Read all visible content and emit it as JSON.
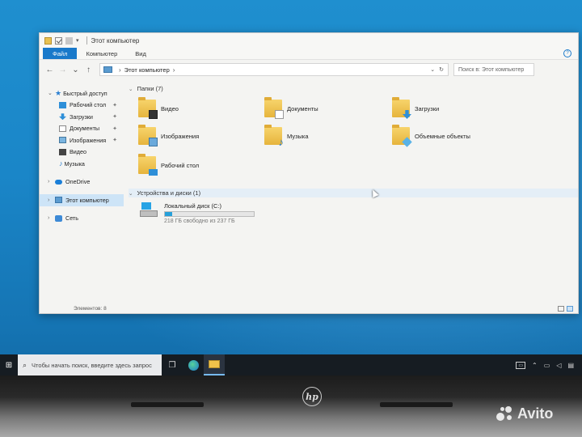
{
  "window": {
    "title": "Этот компьютер",
    "ribbon_tabs": [
      "Файл",
      "Компьютер",
      "Вид"
    ],
    "help": "?"
  },
  "address": {
    "path": "Этот компьютер",
    "search_placeholder": "Поиск в: Этот компьютер"
  },
  "sidebar": {
    "quick_access": "Быстрый доступ",
    "quick_items": [
      {
        "label": "Рабочий стол",
        "icon": "desktop-icon",
        "pinned": true
      },
      {
        "label": "Загрузки",
        "icon": "download-icon",
        "pinned": true
      },
      {
        "label": "Документы",
        "icon": "documents-icon",
        "pinned": true
      },
      {
        "label": "Изображения",
        "icon": "pictures-icon",
        "pinned": true
      },
      {
        "label": "Видео",
        "icon": "video-icon",
        "pinned": false
      },
      {
        "label": "Музыка",
        "icon": "music-icon",
        "pinned": false
      }
    ],
    "onedrive": "OneDrive",
    "this_pc": "Этот компьютер",
    "network": "Сеть"
  },
  "folders_group": "Папки (7)",
  "folders": [
    {
      "label": "Видео",
      "icon": "video-folder-icon"
    },
    {
      "label": "Документы",
      "icon": "documents-folder-icon"
    },
    {
      "label": "Загрузки",
      "icon": "downloads-folder-icon"
    },
    {
      "label": "Изображения",
      "icon": "pictures-folder-icon"
    },
    {
      "label": "Музыка",
      "icon": "music-folder-icon"
    },
    {
      "label": "Объемные объекты",
      "icon": "3d-objects-folder-icon"
    },
    {
      "label": "Рабочий стол",
      "icon": "desktop-folder-icon"
    }
  ],
  "drives_group": "Устройства и диски (1)",
  "drive": {
    "name": "Локальный диск (C:)",
    "free_text": "218 ГБ свободно из 237 ГБ",
    "used_fraction": 0.08
  },
  "status": "Элементов: 8",
  "taskbar": {
    "search_placeholder": "Чтобы начать поиск, введите здесь запрос"
  },
  "brand": "hp",
  "watermark": "Avito"
}
